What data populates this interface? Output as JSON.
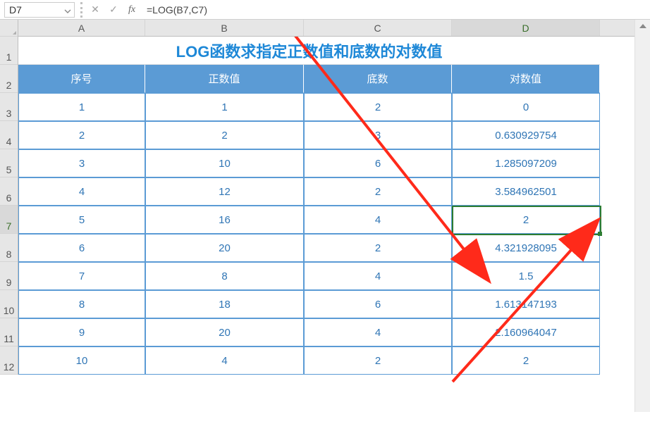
{
  "formula_bar": {
    "name_box": "D7",
    "cancel_icon": "✕",
    "enter_icon": "✓",
    "fx_label": "fx",
    "formula": "=LOG(B7,C7)"
  },
  "column_headers": [
    "A",
    "B",
    "C",
    "D"
  ],
  "row_numbers": [
    "1",
    "2",
    "3",
    "4",
    "5",
    "6",
    "7",
    "8",
    "9",
    "10",
    "11",
    "12"
  ],
  "title": "LOG函数求指定正数值和底数的对数值",
  "table_headers": [
    "序号",
    "正数值",
    "底数",
    "对数值"
  ],
  "rows": [
    {
      "n": "1",
      "pos": "1",
      "base": "2",
      "log": "0"
    },
    {
      "n": "2",
      "pos": "2",
      "base": "3",
      "log": "0.630929754"
    },
    {
      "n": "3",
      "pos": "10",
      "base": "6",
      "log": "1.285097209"
    },
    {
      "n": "4",
      "pos": "12",
      "base": "2",
      "log": "3.584962501"
    },
    {
      "n": "5",
      "pos": "16",
      "base": "4",
      "log": "2"
    },
    {
      "n": "6",
      "pos": "20",
      "base": "2",
      "log": "4.321928095"
    },
    {
      "n": "7",
      "pos": "8",
      "base": "4",
      "log": "1.5"
    },
    {
      "n": "8",
      "pos": "18",
      "base": "6",
      "log": "1.613147193"
    },
    {
      "n": "9",
      "pos": "20",
      "base": "4",
      "log": "2.160964047"
    },
    {
      "n": "10",
      "pos": "4",
      "base": "2",
      "log": "2"
    }
  ],
  "selected_cell": "D7",
  "colors": {
    "header_bg": "#5b9bd5",
    "accent_text": "#2f75b5",
    "title": "#1e88d7",
    "arrow": "#ff2a1a"
  },
  "chart_data": {
    "type": "table",
    "title": "LOG函数求指定正数值和底数的对数值",
    "columns": [
      "序号",
      "正数值",
      "底数",
      "对数值"
    ],
    "data": [
      [
        1,
        1,
        2,
        0
      ],
      [
        2,
        2,
        3,
        0.630929754
      ],
      [
        3,
        10,
        6,
        1.285097209
      ],
      [
        4,
        12,
        2,
        3.584962501
      ],
      [
        5,
        16,
        4,
        2
      ],
      [
        6,
        20,
        2,
        4.321928095
      ],
      [
        7,
        8,
        4,
        1.5
      ],
      [
        8,
        18,
        6,
        1.613147193
      ],
      [
        9,
        20,
        4,
        2.160964047
      ],
      [
        10,
        4,
        2,
        2
      ]
    ]
  }
}
